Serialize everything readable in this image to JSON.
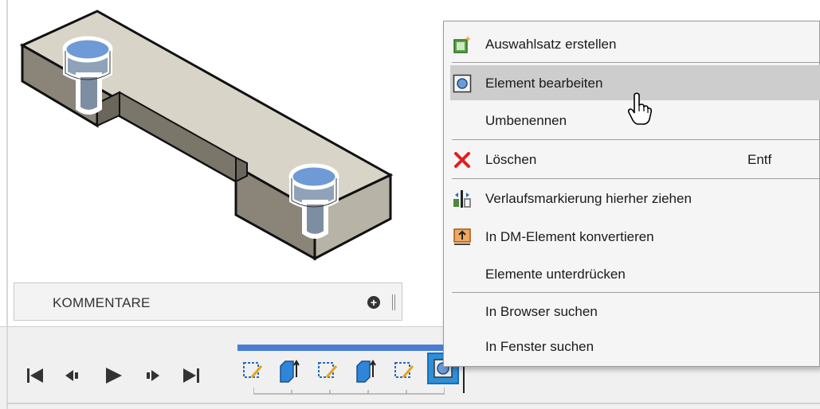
{
  "comments": {
    "label": "KOMMENTARE",
    "add_icon": "plus-circle-icon"
  },
  "playback": {
    "buttons": [
      "skip-to-start-icon",
      "step-back-icon",
      "play-icon",
      "step-forward-icon",
      "skip-to-end-icon"
    ]
  },
  "timeline": {
    "items": [
      "sketch-icon",
      "extrude-icon",
      "sketch-icon",
      "extrude-icon",
      "sketch-icon",
      "hole-icon"
    ],
    "active_index": 5,
    "accent_color": "#4a7cd6"
  },
  "context_menu": {
    "items": [
      {
        "label": "Auswahlsatz erstellen",
        "icon": "selection-set-icon",
        "shortcut": ""
      },
      {
        "label": "Element bearbeiten",
        "icon": "edit-feature-icon",
        "shortcut": ""
      },
      {
        "label": "Umbenennen",
        "icon": "",
        "shortcut": ""
      },
      {
        "label": "Löschen",
        "icon": "delete-icon",
        "shortcut": "Entf"
      },
      {
        "label": "Verlaufsmarkierung hierher ziehen",
        "icon": "rollback-marker-icon",
        "shortcut": ""
      },
      {
        "label": "In DM-Element konvertieren",
        "icon": "convert-dm-icon",
        "shortcut": ""
      },
      {
        "label": "Elemente unterdrücken",
        "icon": "",
        "shortcut": ""
      },
      {
        "label": "In Browser suchen",
        "icon": "",
        "shortcut": ""
      },
      {
        "label": "In Fenster suchen",
        "icon": "",
        "shortcut": ""
      }
    ],
    "hovered_index": 1,
    "delete_color": "#e02020",
    "hover_color": "#cdcdcd"
  }
}
